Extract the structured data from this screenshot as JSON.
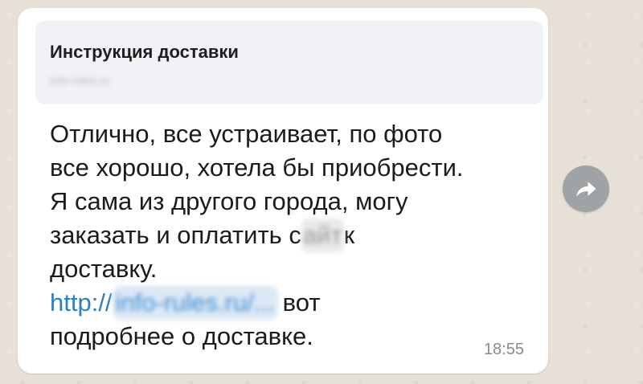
{
  "message": {
    "preview": {
      "title": "Инструкция доставки",
      "domain": "info-rules.ru"
    },
    "lines": [
      "Отлично, все устраивает, по фото",
      "все хорошо, хотела бы приобрести.",
      "Я сама из другого города, могу"
    ],
    "line4_before": "заказать и оплатить с",
    "line4_blur": "айт",
    "line4_after": "к",
    "line5": "доставку.",
    "link_prefix": "http://",
    "link_blurred": "info-rules.ru/...",
    "link_suffix": "вот",
    "line7": "подробнее о доставке.",
    "time": "18:55"
  },
  "icons": {
    "forward": "forward-arrow-icon"
  },
  "colors": {
    "wallpaper": "#e6e0d6",
    "bubble": "#ffffff",
    "link": "#2f7fbf",
    "forward_button": "#9fa3a6"
  }
}
